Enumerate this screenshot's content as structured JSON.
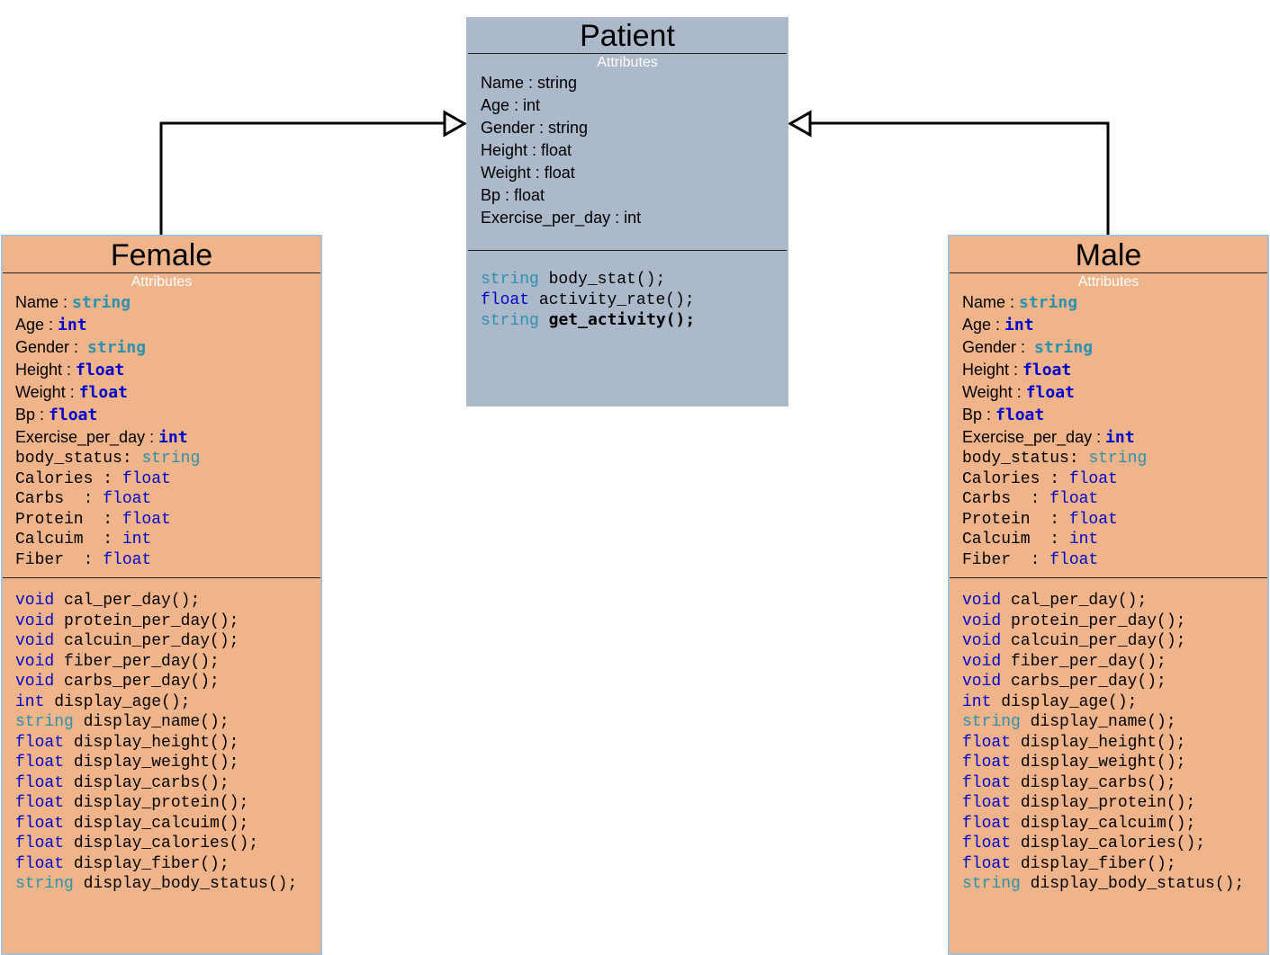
{
  "patient": {
    "title": "Patient",
    "section_label": "Attributes",
    "attributes": [
      "Name : string",
      "Age : int",
      "Gender : string",
      "Height : float",
      "Weight : float",
      "Bp : float",
      "Exercise_per_day : int"
    ],
    "methods": [
      {
        "type": "string",
        "name": "body_stat();"
      },
      {
        "type": "float",
        "name": "activity_rate();"
      },
      {
        "type": "string",
        "name": "get_activity();"
      }
    ]
  },
  "female": {
    "title": "Female",
    "section_label": "Attributes",
    "attributes": [
      {
        "name": "Name : ",
        "type": "string"
      },
      {
        "name": "Age : ",
        "type": "int"
      },
      {
        "name": "Gender :  ",
        "type": "string"
      },
      {
        "name": "Height : ",
        "type": "float"
      },
      {
        "name": "Weight : ",
        "type": "float"
      },
      {
        "name": "Bp : ",
        "type": "float"
      },
      {
        "name": "Exercise_per_day : ",
        "type": "int"
      }
    ],
    "mono_attributes": [
      {
        "name": "body_status: ",
        "type": "string"
      },
      {
        "name": "Calories : ",
        "type": "float"
      },
      {
        "name": "Carbs  : ",
        "type": "float"
      },
      {
        "name": "Protein  : ",
        "type": "float"
      },
      {
        "name": "Calcuim  : ",
        "type": "int"
      },
      {
        "name": "Fiber  : ",
        "type": "float"
      }
    ],
    "methods": [
      {
        "type": "void",
        "name": " cal_per_day();"
      },
      {
        "type": "void",
        "name": " protein_per_day();"
      },
      {
        "type": "void",
        "name": " calcuin_per_day();"
      },
      {
        "type": "void",
        "name": " fiber_per_day();"
      },
      {
        "type": "void",
        "name": " carbs_per_day();"
      },
      {
        "type": "int",
        "name": " display_age();"
      },
      {
        "type": "string",
        "name": " display_name();"
      },
      {
        "type": "float",
        "name": " display_height();"
      },
      {
        "type": "float",
        "name": " display_weight();"
      },
      {
        "type": "float",
        "name": " display_carbs();"
      },
      {
        "type": "float",
        "name": " display_protein();"
      },
      {
        "type": "float",
        "name": " display_calcuim();"
      },
      {
        "type": "float",
        "name": " display_calories();"
      },
      {
        "type": "float",
        "name": " display_fiber();"
      },
      {
        "type": "string",
        "name": " display_body_status();"
      }
    ]
  },
  "male": {
    "title": "Male",
    "section_label": "Attributes",
    "attributes": [
      {
        "name": "Name : ",
        "type": "string"
      },
      {
        "name": "Age : ",
        "type": "int"
      },
      {
        "name": "Gender :  ",
        "type": "string"
      },
      {
        "name": "Height : ",
        "type": "float"
      },
      {
        "name": "Weight : ",
        "type": "float"
      },
      {
        "name": "Bp : ",
        "type": "float"
      },
      {
        "name": "Exercise_per_day : ",
        "type": "int"
      }
    ],
    "mono_attributes": [
      {
        "name": "body_status: ",
        "type": "string"
      },
      {
        "name": "Calories : ",
        "type": "float"
      },
      {
        "name": "Carbs  : ",
        "type": "float"
      },
      {
        "name": "Protein  : ",
        "type": "float"
      },
      {
        "name": "Calcuim  : ",
        "type": "int"
      },
      {
        "name": "Fiber  : ",
        "type": "float"
      }
    ],
    "methods": [
      {
        "type": "void",
        "name": " cal_per_day();"
      },
      {
        "type": "void",
        "name": " protein_per_day();"
      },
      {
        "type": "void",
        "name": " calcuin_per_day();"
      },
      {
        "type": "void",
        "name": " fiber_per_day();"
      },
      {
        "type": "void",
        "name": " carbs_per_day();"
      },
      {
        "type": "int",
        "name": " display_age();"
      },
      {
        "type": "string",
        "name": " display_name();"
      },
      {
        "type": "float",
        "name": " display_height();"
      },
      {
        "type": "float",
        "name": " display_weight();"
      },
      {
        "type": "float",
        "name": " display_carbs();"
      },
      {
        "type": "float",
        "name": " display_protein();"
      },
      {
        "type": "float",
        "name": " display_calcuim();"
      },
      {
        "type": "float",
        "name": " display_calories();"
      },
      {
        "type": "float",
        "name": " display_fiber();"
      },
      {
        "type": "string",
        "name": " display_body_status();"
      }
    ]
  },
  "colors": {
    "patient_fill": "#acb9ca",
    "subclass_fill": "#efb48a",
    "type_blue": "#0000cc",
    "type_teal": "#2b91af"
  }
}
